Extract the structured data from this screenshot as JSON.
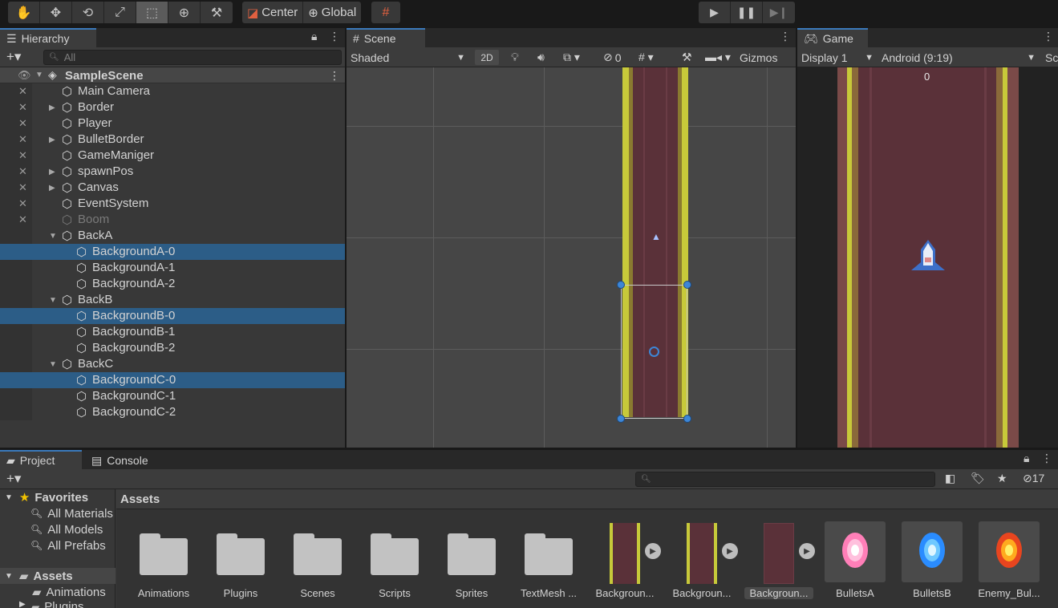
{
  "toolbar": {
    "tools": [
      "hand-tool",
      "move-tool",
      "rotate-tool",
      "scale-tool",
      "rect-tool",
      "transform-tool",
      "custom-tool"
    ],
    "active_tool": "rect-tool",
    "pivot_label": "Center",
    "space_label": "Global",
    "play_controls": [
      "play",
      "pause",
      "step"
    ]
  },
  "hierarchy": {
    "tab_label": "Hierarchy",
    "search_placeholder": "All",
    "scene_name": "SampleScene",
    "items": [
      {
        "label": "Main Camera"
      },
      {
        "label": "Border"
      },
      {
        "label": "Player"
      },
      {
        "label": "BulletBorder"
      },
      {
        "label": "GameManiger"
      },
      {
        "label": "spawnPos"
      },
      {
        "label": "Canvas"
      },
      {
        "label": "EventSystem"
      },
      {
        "label": "Boom"
      },
      {
        "label": "BackA"
      },
      {
        "label": "BackgroundA-0"
      },
      {
        "label": "BackgroundA-1"
      },
      {
        "label": "BackgroundA-2"
      },
      {
        "label": "BackB"
      },
      {
        "label": "BackgroundB-0"
      },
      {
        "label": "BackgroundB-1"
      },
      {
        "label": "BackgroundB-2"
      },
      {
        "label": "BackC"
      },
      {
        "label": "BackgroundC-0"
      },
      {
        "label": "BackgroundC-1"
      },
      {
        "label": "BackgroundC-2"
      }
    ]
  },
  "scene": {
    "tab_label": "Scene",
    "shading_mode": "Shaded",
    "mode_2d": "2D",
    "hidden_count": "0",
    "gizmos_label": "Gizmos"
  },
  "game": {
    "tab_label": "Game",
    "display": "Display 1",
    "resolution": "Android (9:19)",
    "scale_label": "Sc",
    "score": "0"
  },
  "project": {
    "tab_project": "Project",
    "tab_console": "Console",
    "hidden_count": "17",
    "favorites_label": "Favorites",
    "favorites": [
      "All Materials",
      "All Models",
      "All Prefabs"
    ],
    "assets_label": "Assets",
    "tree_children": [
      "Animations",
      "Plugins"
    ],
    "breadcrumb": "Assets",
    "folders": [
      "Animations",
      "Plugins",
      "Scenes",
      "Scripts",
      "Sprites",
      "TextMesh ..."
    ],
    "sprite_assets": [
      "Backgroun...",
      "Backgroun...",
      "Backgroun..."
    ],
    "bullet_assets": [
      "BulletsA",
      "BulletsB",
      "Enemy_Bul..."
    ]
  },
  "colors": {
    "selection": "#2c5d87",
    "accent": "#3a79bb",
    "road": "#5a3139",
    "edge_yellow": "#c7c93a",
    "handle_blue": "#3d86d6"
  }
}
